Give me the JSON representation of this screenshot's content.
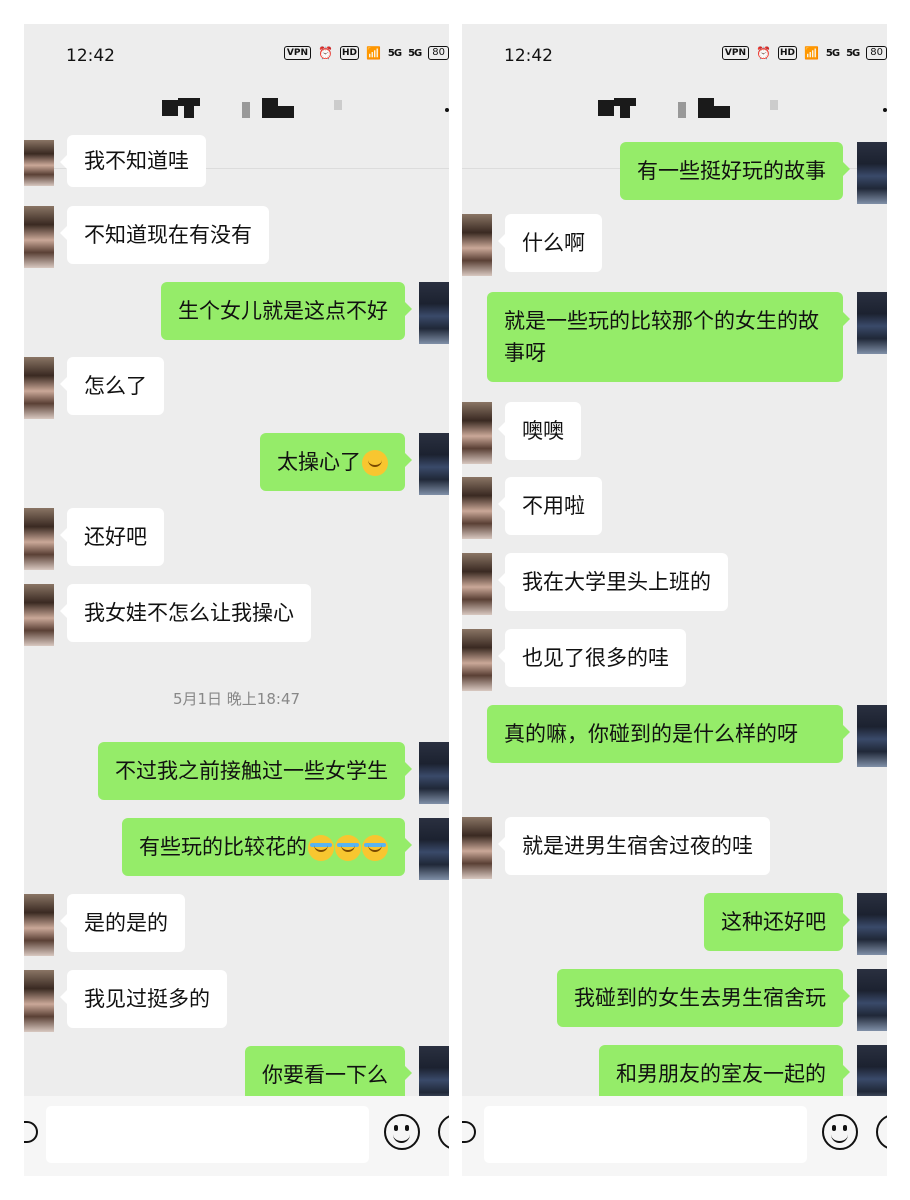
{
  "status_bar": {
    "time": "12:42",
    "vpn": "VPN",
    "hd": "HD",
    "signal_a": "5G",
    "signal_b": "5G",
    "battery": "80"
  },
  "left": {
    "messages": [
      {
        "side": "them",
        "text": "我不知道哇"
      },
      {
        "side": "them",
        "text": "不知道现在有没有"
      },
      {
        "side": "me",
        "text": "生个女儿就是这点不好"
      },
      {
        "side": "them",
        "text": "怎么了"
      },
      {
        "side": "me",
        "text": "太操心了",
        "emoji": "thinking-face-emoji"
      },
      {
        "side": "them",
        "text": "还好吧"
      },
      {
        "side": "them",
        "text": "我女娃不怎么让我操心"
      },
      {
        "side": "me",
        "text": "不过我之前接触过一些女学生"
      },
      {
        "side": "me",
        "text": "有些玩的比较花的",
        "emoji": "crying-laughing-emoji x3"
      },
      {
        "side": "them",
        "text": "是的是的"
      },
      {
        "side": "them",
        "text": "我见过挺多的"
      },
      {
        "side": "me",
        "text": "你要看一下么"
      }
    ],
    "timestamp": "5月1日 晚上18:47"
  },
  "right": {
    "messages": [
      {
        "side": "me",
        "text": "有一些挺好玩的故事"
      },
      {
        "side": "them",
        "text": "什么啊"
      },
      {
        "side": "me",
        "text": "就是一些玩的比较那个的女生的故事呀"
      },
      {
        "side": "them",
        "text": "噢噢"
      },
      {
        "side": "them",
        "text": "不用啦"
      },
      {
        "side": "them",
        "text": "我在大学里头上班的"
      },
      {
        "side": "them",
        "text": "也见了很多的哇"
      },
      {
        "side": "me",
        "text": "真的嘛，你碰到的是什么样的呀"
      },
      {
        "side": "them",
        "text": "就是进男生宿舍过夜的哇"
      },
      {
        "side": "me",
        "text": "这种还好吧"
      },
      {
        "side": "me",
        "text": "我碰到的女生去男生宿舍玩"
      },
      {
        "side": "me",
        "text": "和男朋友的室友一起的"
      }
    ]
  },
  "colors": {
    "background": "#ededed",
    "sent_bubble": "#95ec69",
    "received_bubble": "#ffffff"
  },
  "icons": [
    "voice-toggle-icon",
    "emoji-icon",
    "plus-icon",
    "more-icon"
  ]
}
